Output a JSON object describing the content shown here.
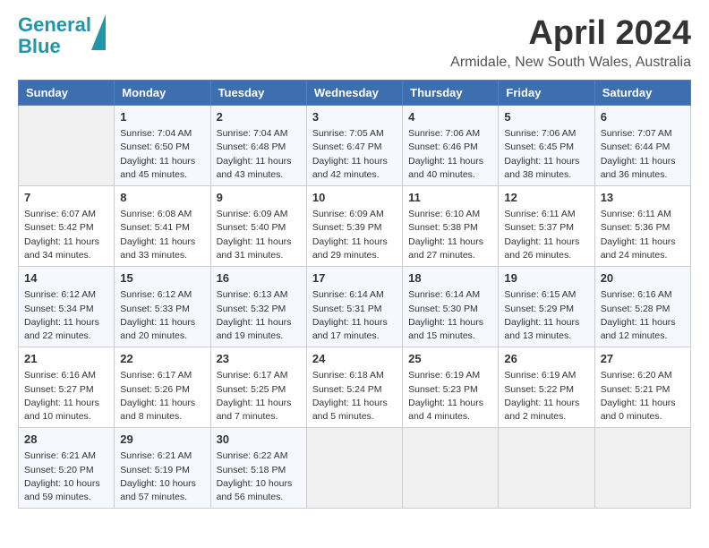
{
  "header": {
    "logo_line1": "General",
    "logo_line2": "Blue",
    "title": "April 2024",
    "subtitle": "Armidale, New South Wales, Australia"
  },
  "days_of_week": [
    "Sunday",
    "Monday",
    "Tuesday",
    "Wednesday",
    "Thursday",
    "Friday",
    "Saturday"
  ],
  "weeks": [
    [
      {
        "day": "",
        "empty": true
      },
      {
        "day": "1",
        "sunrise": "7:04 AM",
        "sunset": "6:50 PM",
        "daylight": "11 hours and 45 minutes."
      },
      {
        "day": "2",
        "sunrise": "7:04 AM",
        "sunset": "6:48 PM",
        "daylight": "11 hours and 43 minutes."
      },
      {
        "day": "3",
        "sunrise": "7:05 AM",
        "sunset": "6:47 PM",
        "daylight": "11 hours and 42 minutes."
      },
      {
        "day": "4",
        "sunrise": "7:06 AM",
        "sunset": "6:46 PM",
        "daylight": "11 hours and 40 minutes."
      },
      {
        "day": "5",
        "sunrise": "7:06 AM",
        "sunset": "6:45 PM",
        "daylight": "11 hours and 38 minutes."
      },
      {
        "day": "6",
        "sunrise": "7:07 AM",
        "sunset": "6:44 PM",
        "daylight": "11 hours and 36 minutes."
      }
    ],
    [
      {
        "day": "7",
        "sunrise": "6:07 AM",
        "sunset": "5:42 PM",
        "daylight": "11 hours and 34 minutes."
      },
      {
        "day": "8",
        "sunrise": "6:08 AM",
        "sunset": "5:41 PM",
        "daylight": "11 hours and 33 minutes."
      },
      {
        "day": "9",
        "sunrise": "6:09 AM",
        "sunset": "5:40 PM",
        "daylight": "11 hours and 31 minutes."
      },
      {
        "day": "10",
        "sunrise": "6:09 AM",
        "sunset": "5:39 PM",
        "daylight": "11 hours and 29 minutes."
      },
      {
        "day": "11",
        "sunrise": "6:10 AM",
        "sunset": "5:38 PM",
        "daylight": "11 hours and 27 minutes."
      },
      {
        "day": "12",
        "sunrise": "6:11 AM",
        "sunset": "5:37 PM",
        "daylight": "11 hours and 26 minutes."
      },
      {
        "day": "13",
        "sunrise": "6:11 AM",
        "sunset": "5:36 PM",
        "daylight": "11 hours and 24 minutes."
      }
    ],
    [
      {
        "day": "14",
        "sunrise": "6:12 AM",
        "sunset": "5:34 PM",
        "daylight": "11 hours and 22 minutes."
      },
      {
        "day": "15",
        "sunrise": "6:12 AM",
        "sunset": "5:33 PM",
        "daylight": "11 hours and 20 minutes."
      },
      {
        "day": "16",
        "sunrise": "6:13 AM",
        "sunset": "5:32 PM",
        "daylight": "11 hours and 19 minutes."
      },
      {
        "day": "17",
        "sunrise": "6:14 AM",
        "sunset": "5:31 PM",
        "daylight": "11 hours and 17 minutes."
      },
      {
        "day": "18",
        "sunrise": "6:14 AM",
        "sunset": "5:30 PM",
        "daylight": "11 hours and 15 minutes."
      },
      {
        "day": "19",
        "sunrise": "6:15 AM",
        "sunset": "5:29 PM",
        "daylight": "11 hours and 13 minutes."
      },
      {
        "day": "20",
        "sunrise": "6:16 AM",
        "sunset": "5:28 PM",
        "daylight": "11 hours and 12 minutes."
      }
    ],
    [
      {
        "day": "21",
        "sunrise": "6:16 AM",
        "sunset": "5:27 PM",
        "daylight": "11 hours and 10 minutes."
      },
      {
        "day": "22",
        "sunrise": "6:17 AM",
        "sunset": "5:26 PM",
        "daylight": "11 hours and 8 minutes."
      },
      {
        "day": "23",
        "sunrise": "6:17 AM",
        "sunset": "5:25 PM",
        "daylight": "11 hours and 7 minutes."
      },
      {
        "day": "24",
        "sunrise": "6:18 AM",
        "sunset": "5:24 PM",
        "daylight": "11 hours and 5 minutes."
      },
      {
        "day": "25",
        "sunrise": "6:19 AM",
        "sunset": "5:23 PM",
        "daylight": "11 hours and 4 minutes."
      },
      {
        "day": "26",
        "sunrise": "6:19 AM",
        "sunset": "5:22 PM",
        "daylight": "11 hours and 2 minutes."
      },
      {
        "day": "27",
        "sunrise": "6:20 AM",
        "sunset": "5:21 PM",
        "daylight": "11 hours and 0 minutes."
      }
    ],
    [
      {
        "day": "28",
        "sunrise": "6:21 AM",
        "sunset": "5:20 PM",
        "daylight": "10 hours and 59 minutes."
      },
      {
        "day": "29",
        "sunrise": "6:21 AM",
        "sunset": "5:19 PM",
        "daylight": "10 hours and 57 minutes."
      },
      {
        "day": "30",
        "sunrise": "6:22 AM",
        "sunset": "5:18 PM",
        "daylight": "10 hours and 56 minutes."
      },
      {
        "day": "",
        "empty": true
      },
      {
        "day": "",
        "empty": true
      },
      {
        "day": "",
        "empty": true
      },
      {
        "day": "",
        "empty": true
      }
    ]
  ]
}
